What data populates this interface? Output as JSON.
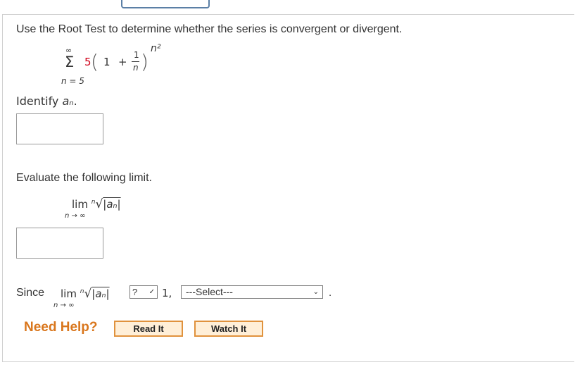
{
  "question": "Use the Root Test to determine whether the series is convergent or divergent.",
  "series": {
    "sum_upper": "∞",
    "sum_lower": "n = 5",
    "coefficient": "5",
    "one": "1",
    "plus": "+",
    "frac_num": "1",
    "frac_den": "n",
    "exponent": "n²"
  },
  "identify": {
    "prefix": "Identify ",
    "var": "aₙ",
    "suffix": "."
  },
  "evaluate": "Evaluate the following limit.",
  "limit": {
    "lim": "lim",
    "sub": "n → ∞",
    "root_index": "n",
    "expr": "|aₙ|"
  },
  "since": {
    "label": "Since",
    "compare_value": "?",
    "one": "1,",
    "select_value": "---Select---",
    "period": "."
  },
  "help": {
    "label": "Need Help?",
    "read_it": "Read It",
    "watch_it": "Watch It"
  },
  "colors": {
    "coefficient": "#d0021b",
    "need_help": "#d9761c",
    "button_bg": "#ffefd8",
    "button_border": "#e0923d"
  }
}
